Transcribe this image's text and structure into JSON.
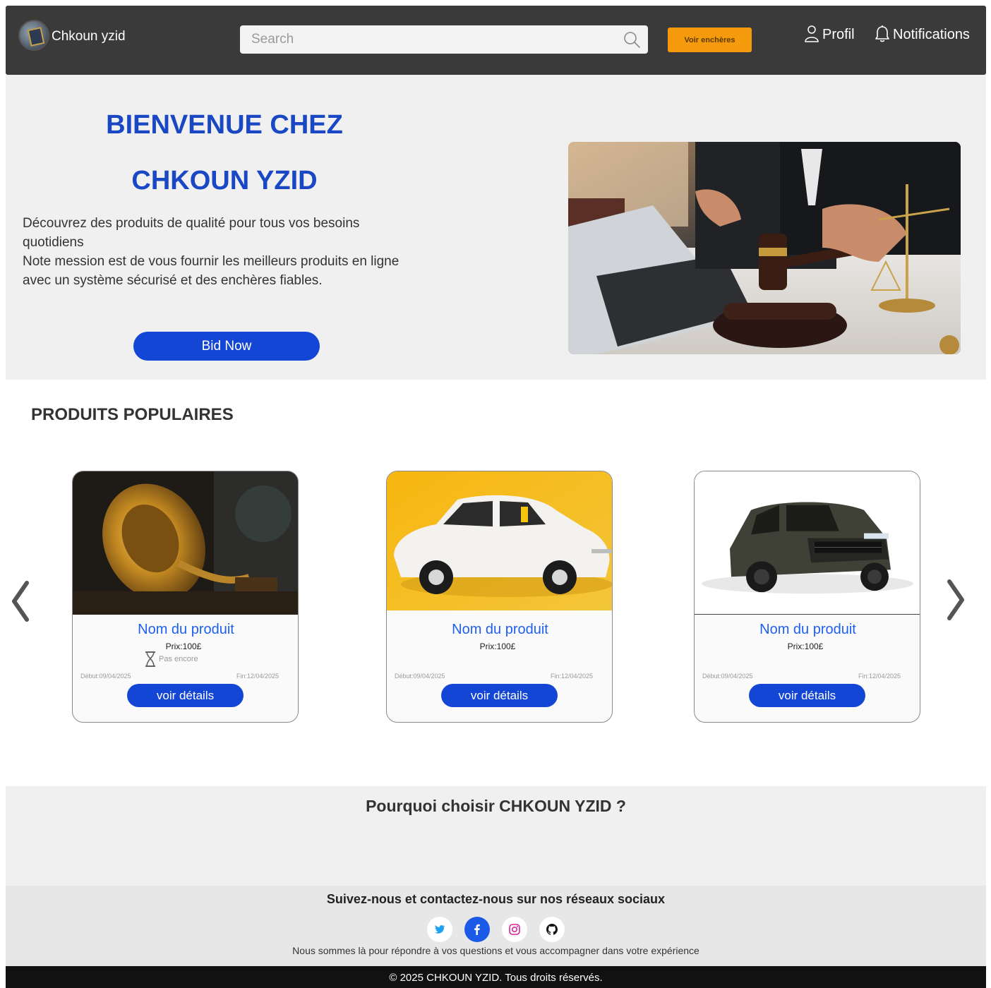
{
  "header": {
    "brand_name": "Chkoun yzid",
    "search_placeholder": "Search",
    "auctions_button": "Voir enchères",
    "profile_label": "Profil",
    "notifications_label": "Notifications"
  },
  "hero": {
    "title_line1": "BIENVENUE CHEZ",
    "title_line2": "CHKOUN YZID",
    "text_line1": "Découvrez des produits de qualité pour tous vos besoins quotidiens",
    "text_line2": "Note mession est de vous fournir les meilleurs produits en ligne avec un système sécurisé et des enchères fiables.",
    "cta": "Bid Now"
  },
  "popular": {
    "title": "PRODUITS POPULAIRES",
    "cards": [
      {
        "name": "Nom du produit",
        "price": "Prix:100£",
        "status": "Pas encore",
        "start": "Début:09/04/2025",
        "end": "Fin:12/04/2025",
        "button": "voir détails"
      },
      {
        "name": "Nom du produit",
        "price": "Prix:100£",
        "start": "Début:09/04/2025",
        "end": "Fin:12/04/2025",
        "button": "voir détails"
      },
      {
        "name": "Nom du produit",
        "price": "Prix:100£",
        "start": "Début:09/04/2025",
        "end": "Fin:12/04/2025",
        "button": "voir détails"
      }
    ]
  },
  "why": {
    "title": "Pourquoi choisir  CHKOUN YZID ?"
  },
  "social": {
    "title": "Suivez-nous et  contactez-nous sur nos réseaux sociaux",
    "icons": [
      "twitter-icon",
      "facebook-icon",
      "instagram-icon",
      "github-icon"
    ],
    "subtitle": "Nous sommes là pour répondre à vos questions et vous accompagner dans votre expérience"
  },
  "footer": {
    "copyright": "© 2025 CHKOUN YZID. Tous droits réservés."
  },
  "colors": {
    "navbar": "#3a3a3a",
    "accent_orange": "#f59a0c",
    "primary_blue": "#1446d6",
    "title_blue": "#1a47c4",
    "link_blue": "#1e5ff0",
    "hero_bg": "#f0f0f0",
    "footer_bg": "#111111"
  }
}
